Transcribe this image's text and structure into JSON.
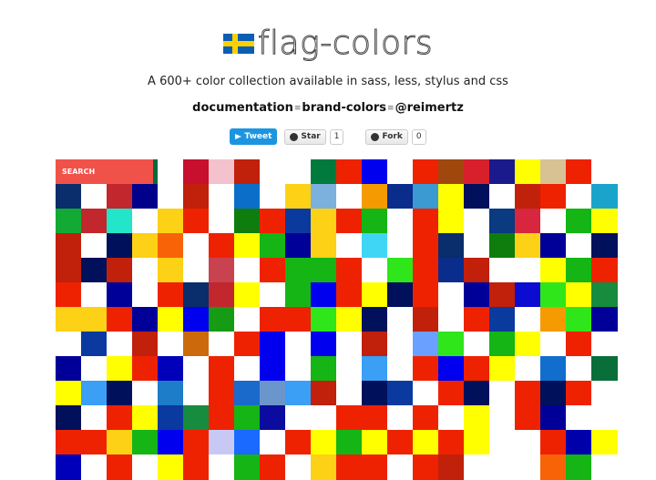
{
  "header": {
    "title": "flag-colors",
    "subtitle": "A 600+ color collection available in sass, less, stylus and css",
    "links": [
      "documentation",
      "brand-colors",
      "@reimertz"
    ],
    "tweet_label": "Tweet",
    "star_label": "Star",
    "star_count": "1",
    "fork_label": "Fork",
    "fork_count": "0"
  },
  "search": {
    "placeholder": "SEARCH"
  },
  "grid": {
    "rows": [
      [
        "#f0524a",
        "#f0524a",
        "#f0524a",
        "#006b3f",
        "#ffffff",
        "#c8102e",
        "#f4c2cc",
        "#c1200b",
        "#ffffff",
        "#ffffff",
        "#007a3d",
        "#ee2200",
        "#0000ee",
        "#ffffff",
        "#ee2200",
        "#a0470e",
        "#d7202c",
        "#1a1a8c",
        "#ffff00",
        "#d8c294",
        "#ee2200",
        "#ffffff"
      ],
      [
        "#0a2d6b",
        "#ffffff",
        "#c1272d",
        "#00008b",
        "#ffffff",
        "#c1200b",
        "#ffffff",
        "#0b6fc9",
        "#ffffff",
        "#fcd116",
        "#7bb1dc",
        "#ffffff",
        "#f59a00",
        "#0a2d8c",
        "#3a9ad1",
        "#ffff00",
        "#00105a",
        "#ffffff",
        "#c1200b",
        "#ee2200",
        "#ffffff",
        "#1aa4cc"
      ],
      [
        "#12aa35",
        "#c1272d",
        "#22e5c9",
        "#ffffff",
        "#fcd116",
        "#ee2200",
        "#ffffff",
        "#0e7d0e",
        "#ee2200",
        "#0b3a9f",
        "#fcd116",
        "#ee2200",
        "#14b514",
        "#ffffff",
        "#ee2200",
        "#ffff00",
        "#ffffff",
        "#0a3a7f",
        "#d7263d",
        "#ffffff",
        "#14b514",
        "#ffff00"
      ],
      [
        "#c1200b",
        "#ffffff",
        "#00105a",
        "#fcd116",
        "#f86308",
        "#ffffff",
        "#ee2200",
        "#ffff00",
        "#14b514",
        "#000099",
        "#fcd116",
        "#ffffff",
        "#3fd6f5",
        "#ffffff",
        "#ee2200",
        "#0a2d6b",
        "#ffffff",
        "#0e7d0e",
        "#fcd116",
        "#000099",
        "#ffffff",
        "#00105a"
      ],
      [
        "#c1200b",
        "#00105a",
        "#c1200b",
        "#ffffff",
        "#fcd116",
        "#ffffff",
        "#c8434f",
        "#ffffff",
        "#ee2200",
        "#14b514",
        "#14b514",
        "#ee2200",
        "#ffffff",
        "#2fe61a",
        "#ee2200",
        "#0a2d8c",
        "#c1200b",
        "#ffffff",
        "#ffffff",
        "#ffff00",
        "#14b514",
        "#ee2200"
      ],
      [
        "#ee2200",
        "#ffffff",
        "#000099",
        "#ffffff",
        "#ee2200",
        "#0a2d6b",
        "#c1272d",
        "#ffff00",
        "#ffffff",
        "#14b514",
        "#0000ee",
        "#ee2200",
        "#ffff00",
        "#00105a",
        "#ee2200",
        "#ffffff",
        "#000099",
        "#c1200b",
        "#0b0bd1",
        "#2fe61a",
        "#ffff00",
        "#178b3e"
      ],
      [
        "#fcd116",
        "#fcd116",
        "#ee2200",
        "#000099",
        "#ffff00",
        "#0000ee",
        "#169b14",
        "#ffffff",
        "#ee2200",
        "#ee2200",
        "#2fe61a",
        "#ffff00",
        "#00105a",
        "#ffffff",
        "#c1200b",
        "#ffffff",
        "#ee2200",
        "#0b3a9f",
        "#ffffff",
        "#f59a00",
        "#2fe61a",
        "#000099"
      ],
      [
        "#ffffff",
        "#0a3a9f",
        "#ffffff",
        "#c1200b",
        "#ffffff",
        "#cc6a0b",
        "#ffffff",
        "#ee2200",
        "#0000ee",
        "#ffffff",
        "#0000ee",
        "#ffffff",
        "#c1200b",
        "#ffffff",
        "#6aa0ff",
        "#2fe61a",
        "#ffffff",
        "#14b514",
        "#ffff00",
        "#ffffff",
        "#ee2200",
        "#ffffff"
      ],
      [
        "#000099",
        "#ffffff",
        "#ffff00",
        "#ee2200",
        "#0000bb",
        "#ffffff",
        "#ee2200",
        "#ffffff",
        "#0000ee",
        "#ffffff",
        "#14b514",
        "#ffffff",
        "#3a9ff5",
        "#ffffff",
        "#ee2200",
        "#0000ee",
        "#ee2200",
        "#ffff00",
        "#ffffff",
        "#126ecc",
        "#ffffff",
        "#0a6e3a"
      ],
      [
        "#ffff00",
        "#3a9ff5",
        "#00105a",
        "#ffffff",
        "#1d7dc9",
        "#ffffff",
        "#ee2200",
        "#1a6acc",
        "#6b96cc",
        "#3a9ff5",
        "#c1200b",
        "#ffffff",
        "#00105a",
        "#0a3a9f",
        "#ffffff",
        "#ee2200",
        "#00105a",
        "#ffffff",
        "#ee2200",
        "#00105a",
        "#ee2200",
        "#ffffff"
      ],
      [
        "#00105a",
        "#ffffff",
        "#ee2200",
        "#ffff00",
        "#0a3a9f",
        "#178b3e",
        "#ee2200",
        "#14b514",
        "#0b0b9f",
        "#ffffff",
        "#ffffff",
        "#ee2200",
        "#ee2200",
        "#ffffff",
        "#ee2200",
        "#ffffff",
        "#ffff00",
        "#ffffff",
        "#ee2200",
        "#000099",
        "#ffffff",
        "#ffffff"
      ],
      [
        "#ee2200",
        "#ee2200",
        "#fcd116",
        "#14b514",
        "#0000ee",
        "#ee2200",
        "#c8c8f5",
        "#1a6aff",
        "#ffffff",
        "#ee2200",
        "#ffff00",
        "#14b514",
        "#ffff00",
        "#ee2200",
        "#ffff00",
        "#ee2200",
        "#ffff00",
        "#ffffff",
        "#ffffff",
        "#ee2200",
        "#0000aa",
        "#ffff00"
      ],
      [
        "#0000bb",
        "#ffffff",
        "#ee2200",
        "#ffffff",
        "#ffff00",
        "#ee2200",
        "#ffffff",
        "#14b514",
        "#ee2200",
        "#ffffff",
        "#fcd116",
        "#ee2200",
        "#ee2200",
        "#ffffff",
        "#ee2200",
        "#c1200b",
        "#ffffff",
        "#ffffff",
        "#ffffff",
        "#f86308",
        "#14b514",
        "#ffffff"
      ]
    ]
  }
}
